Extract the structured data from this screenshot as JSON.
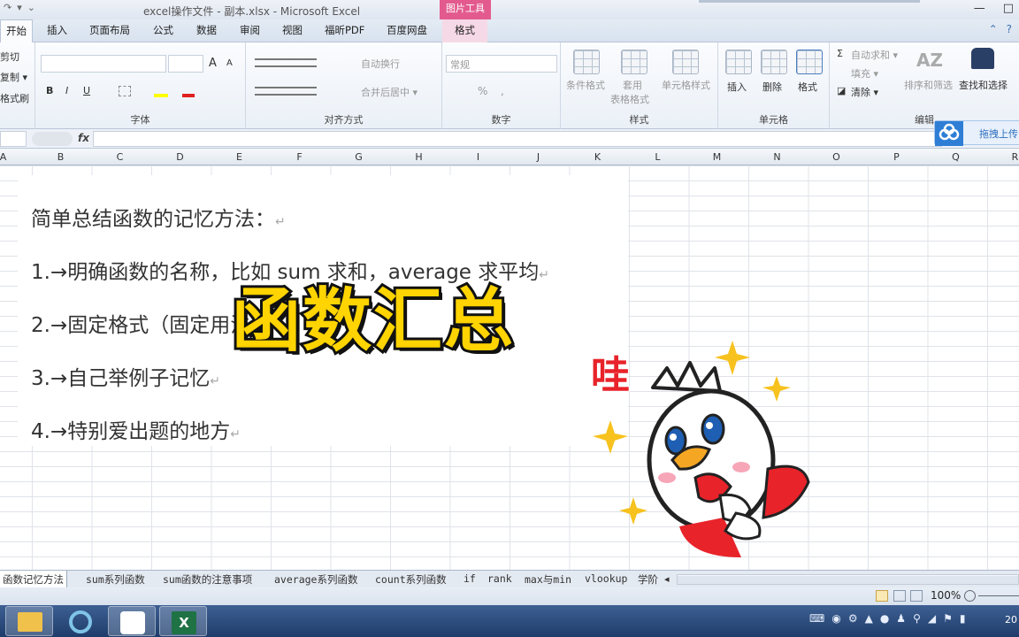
{
  "window": {
    "title": "excel操作文件 - 副本.xlsx - Microsoft Excel",
    "context_tool": "图片工具",
    "controls": [
      "—",
      "□"
    ]
  },
  "tabs": [
    "开始",
    "插入",
    "页面布局",
    "公式",
    "数据",
    "审阅",
    "视图",
    "福昕PDF",
    "百度网盘",
    "格式"
  ],
  "ribbon": {
    "clipboard": [
      "剪切",
      "复制 ▾",
      "格式刷"
    ],
    "font": {
      "label": "字体",
      "bold": "B",
      "italic": "I",
      "underline": "U",
      "grow": "A",
      "shrink": "A"
    },
    "alignment": {
      "label": "对齐方式",
      "wrap": "自动换行",
      "merge": "合并后居中 ▾"
    },
    "number": {
      "label": "数字",
      "format": "常规",
      "percent": "%",
      "comma": ","
    },
    "styles": {
      "label": "样式",
      "conditional": "条件格式",
      "table_line1": "套用",
      "table_line2": "表格格式",
      "cell": "单元格样式"
    },
    "cells": {
      "label": "单元格",
      "insert": "插入",
      "delete": "删除",
      "format": "格式"
    },
    "editing": {
      "label": "编辑",
      "autosum": "自动求和 ▾",
      "fill": "填充 ▾",
      "clear": "清除 ▾",
      "sort": "排序和筛选",
      "find": "查找和选择"
    }
  },
  "formula_bar": {
    "fx": "fx"
  },
  "upload_badge": "拖拽上传",
  "columns": [
    "A",
    "B",
    "C",
    "D",
    "E",
    "F",
    "G",
    "H",
    "I",
    "J",
    "K",
    "L",
    "M",
    "N",
    "O",
    "P",
    "Q",
    "R"
  ],
  "picture_text": {
    "heading": "简单总结函数的记忆方法：",
    "items": [
      "1.→明确函数的名称，比如 sum 求和，average 求平均",
      "2.→固定格式（固定用法）",
      "3.→自己举例子记忆",
      "4.→特别爱出题的地方"
    ],
    "mark": "↵"
  },
  "overlay_title": "函数汇总",
  "sticker_text": "哇",
  "sheet_tabs": [
    "函数记忆方法",
    "sum系列函数",
    "sum函数的注意事项",
    "average系列函数",
    "count系列函数",
    "if",
    "rank",
    "max与min",
    "vlookup",
    "学阶"
  ],
  "status": {
    "zoom": "100%"
  },
  "taskbar": {
    "clock": "20"
  },
  "colors": {
    "excel_green": "#1f7244",
    "accent_pink": "#e35b8e",
    "title_yellow": "#ffd400",
    "sticker_red": "#e8232a"
  }
}
